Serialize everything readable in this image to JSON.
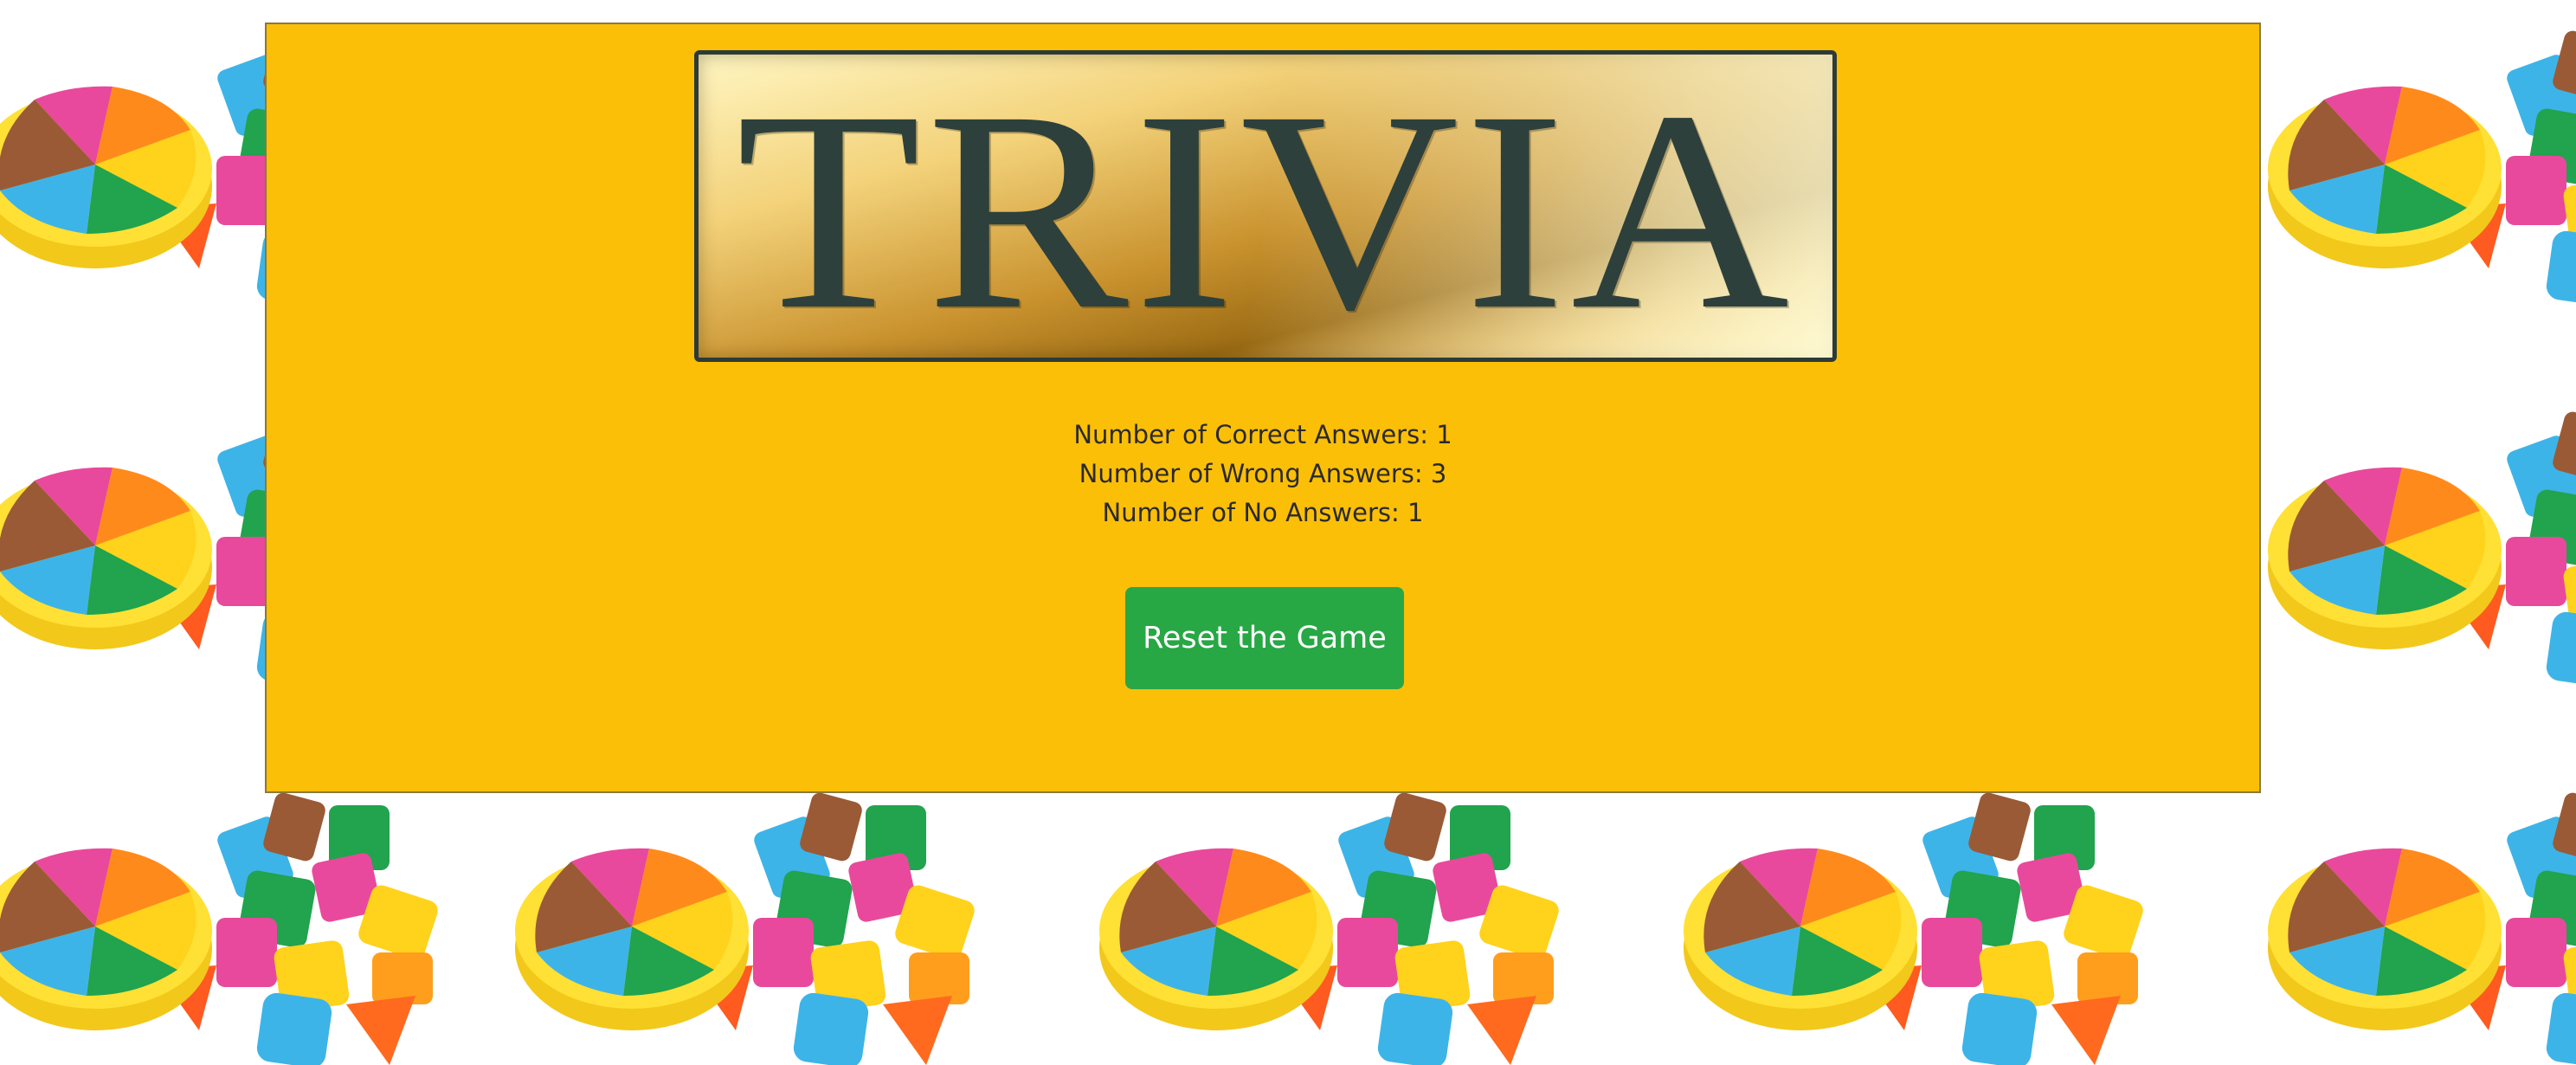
{
  "logo": {
    "text": "TRIVIA"
  },
  "stats": {
    "correct": "Number of Correct Answers: 1",
    "wrong": "Number of Wrong Answers: 3",
    "no_answer": "Number of No Answers: 1"
  },
  "reset_button": {
    "label": "Reset the Game"
  },
  "colors": {
    "panel": "#fcbf08",
    "button": "#28a745",
    "logo_text": "#2d403c"
  },
  "background": {
    "icon": "trivia-game-pieces-tile"
  }
}
